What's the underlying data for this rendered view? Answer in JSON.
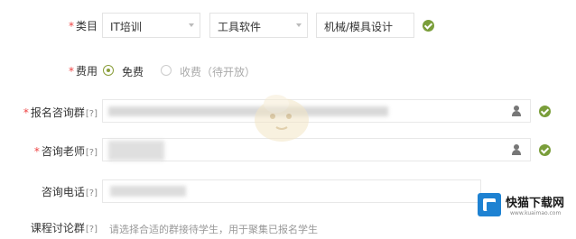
{
  "category": {
    "label": "类目",
    "options": [
      "IT培训",
      "工具软件",
      "机械/模具设计"
    ]
  },
  "fee": {
    "label": "费用",
    "free_label": "免费",
    "paid_label": "收费（待开放）",
    "selected": "免费"
  },
  "signup_group": {
    "label": "报名咨询群",
    "q": "[?]"
  },
  "consult_teacher": {
    "label": "咨询老师",
    "q": "[?]"
  },
  "consult_phone": {
    "label": "咨询电话",
    "q": "[?]"
  },
  "course_group": {
    "label": "课程讨论群",
    "q": "[?]",
    "placeholder": "请选择合适的群接待学生，用于聚集已报名学生"
  },
  "watermark": {
    "name": "快猫下载网",
    "url": "www.kuaimao.com"
  },
  "colors": {
    "accent": "#7a9e3a",
    "required": "#ee4444",
    "brand": "#1e82d2"
  }
}
